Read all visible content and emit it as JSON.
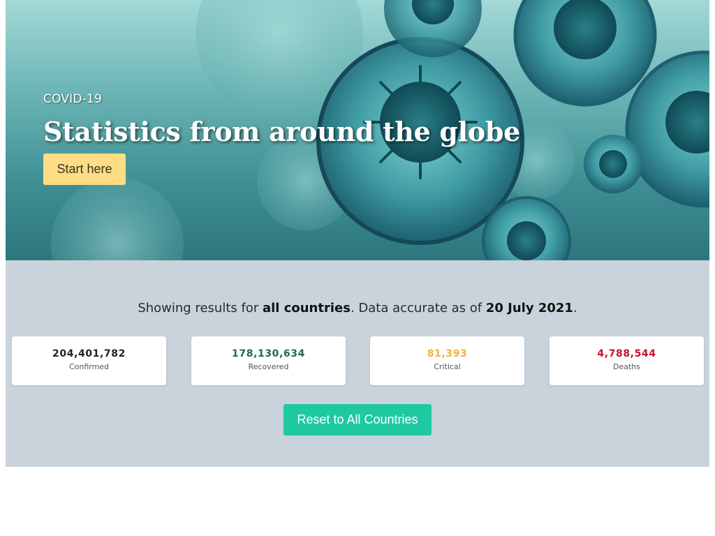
{
  "hero": {
    "kicker": "COVID-19",
    "headline": "Statistics from around the globe",
    "start_button": "Start here"
  },
  "summary": {
    "prefix": "Showing results for ",
    "scope": "all countries",
    "middle": ". Data accurate as of ",
    "date": "20 July 2021",
    "suffix": "."
  },
  "stats": [
    {
      "value": "204,401,782",
      "label": "Confirmed",
      "color": "#222222"
    },
    {
      "value": "178,130,634",
      "label": "Recovered",
      "color": "#1f6b4a"
    },
    {
      "value": "81,393",
      "label": "Critical",
      "color": "#f0b43a"
    },
    {
      "value": "4,788,544",
      "label": "Deaths",
      "color": "#c8102e"
    }
  ],
  "reset_button": "Reset to All Countries",
  "colors": {
    "start_button_bg": "#ffdd85",
    "reset_button_bg": "#1ec9a2",
    "section_bg": "#cad3dc"
  }
}
